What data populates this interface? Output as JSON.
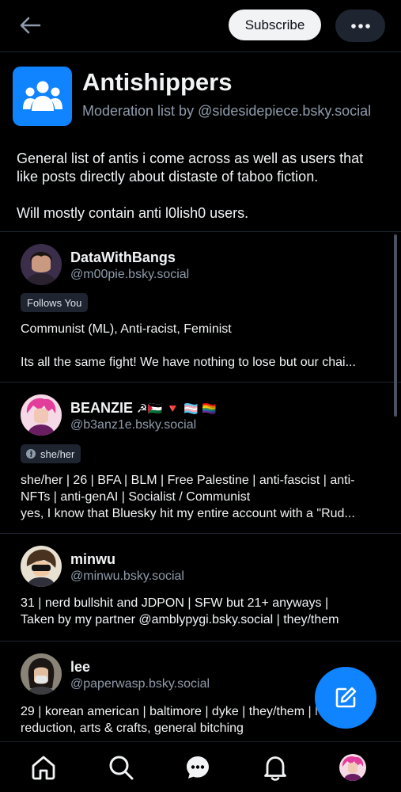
{
  "header": {
    "back_icon": "arrow-left-icon",
    "subscribe_label": "Subscribe",
    "more_icon": "ellipsis-icon"
  },
  "list": {
    "avatar_icon": "people-group-icon",
    "title": "Antishippers",
    "subtitle": "Moderation list by @sidesidepiece.bsky.social",
    "description_p1": "General list of antis i come across as well as users that like posts directly about distaste of taboo fiction.",
    "description_p2": "Will mostly contain anti l0lish0 users."
  },
  "members": [
    {
      "name": "DataWithBangs",
      "handle": "@m00pie.bsky.social",
      "chip": "Follows You",
      "bio": [
        "Communist (ML), Anti-racist, Feminist",
        "",
        "Its all the same fight! We have nothing to lose but our chai..."
      ]
    },
    {
      "name": "BEANZIE",
      "name_emoji": "☭🇵🇸 🔻 🏳️‍⚧️ 🏳️‍🌈",
      "handle": "@b3anz1e.bsky.social",
      "chip": "she/her",
      "bio": [
        "she/her | 26 | BFA | BLM | Free Palestine | anti-fascist | anti-",
        "NFTs | anti-genAI | Socialist / Communist",
        "yes, I know that Bluesky hit my entire account with a \"Rud..."
      ]
    },
    {
      "name": "minwu",
      "handle": "@minwu.bsky.social",
      "bio": [
        "31 | nerd bullshit and JDPON | SFW but 21+ anyways |",
        "Taken by my partner @amblypygi.bsky.social | they/them"
      ]
    },
    {
      "name": "lee",
      "handle": "@paperwasp.bsky.social",
      "bio": [
        "29 | korean american | baltimore | dyke | they/them | harm",
        "reduction, arts & crafts, general bitching"
      ]
    }
  ],
  "fab_icon": "compose-icon",
  "nav": {
    "home_icon": "home-icon",
    "search_icon": "search-icon",
    "chat_icon": "chat-bubble-icon",
    "notifications_icon": "bell-icon",
    "profile_icon": "profile-avatar-icon"
  },
  "colors": {
    "background": "#000000",
    "accent": "#1083fe",
    "muted_text": "#8f9bab",
    "border": "#1e2530"
  }
}
